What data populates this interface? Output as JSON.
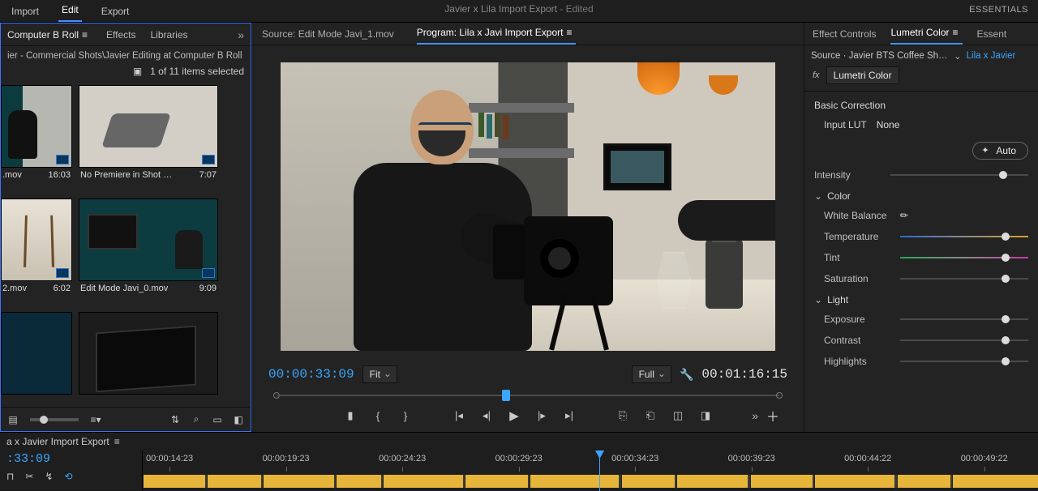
{
  "app": {
    "title": "Javier x Lila Import Export",
    "state": "- Edited",
    "menu": {
      "import": "Import",
      "edit": "Edit",
      "export": "Export"
    },
    "workspace": "ESSENTIALS"
  },
  "project": {
    "tabs": {
      "bin": "Computer B Roll",
      "effects": "Effects",
      "libraries": "Libraries"
    },
    "path": "ier - Commercial Shots\\Javier Editing at Computer B Roll",
    "selection": "1 of 11 items selected",
    "clips": [
      {
        "name": ".mov",
        "dur": "16:03"
      },
      {
        "name": "No Premiere in Shot Editi...",
        "dur": "7:07"
      },
      {
        "name": "2.mov",
        "dur": "6:02"
      },
      {
        "name": "Edit Mode Javi_0.mov",
        "dur": "9:09"
      }
    ]
  },
  "center": {
    "source_tab": "Source: Edit Mode Javi_1.mov",
    "program_tab": "Program: Lila x Javi Import Export",
    "tc_in": "00:00:33:09",
    "tc_out": "00:01:16:15",
    "zoom": "Fit",
    "res": "Full"
  },
  "lumetri": {
    "tabs": {
      "ec": "Effect Controls",
      "lc": "Lumetri Color",
      "es": "Essent"
    },
    "src1": "Source · Javier BTS Coffee Shoot...",
    "src2": "Lila x Javier",
    "fx_name": "Lumetri Color",
    "section": "Basic Correction",
    "lut_label": "Input LUT",
    "lut_value": "None",
    "auto": "Auto",
    "intensity": "Intensity",
    "group_color": "Color",
    "wb": "White Balance",
    "temperature": "Temperature",
    "tint": "Tint",
    "saturation": "Saturation",
    "group_light": "Light",
    "exposure": "Exposure",
    "contrast": "Contrast",
    "highlights": "Highlights"
  },
  "timeline": {
    "tab": "a x Javier Import Export",
    "tc": ":33:09",
    "ticks": [
      "00:00:14:23",
      "00:00:19:23",
      "00:00:24:23",
      "00:00:29:23",
      "00:00:34:23",
      "00:00:39:23",
      "00:00:44:22",
      "00:00:49:22"
    ]
  }
}
